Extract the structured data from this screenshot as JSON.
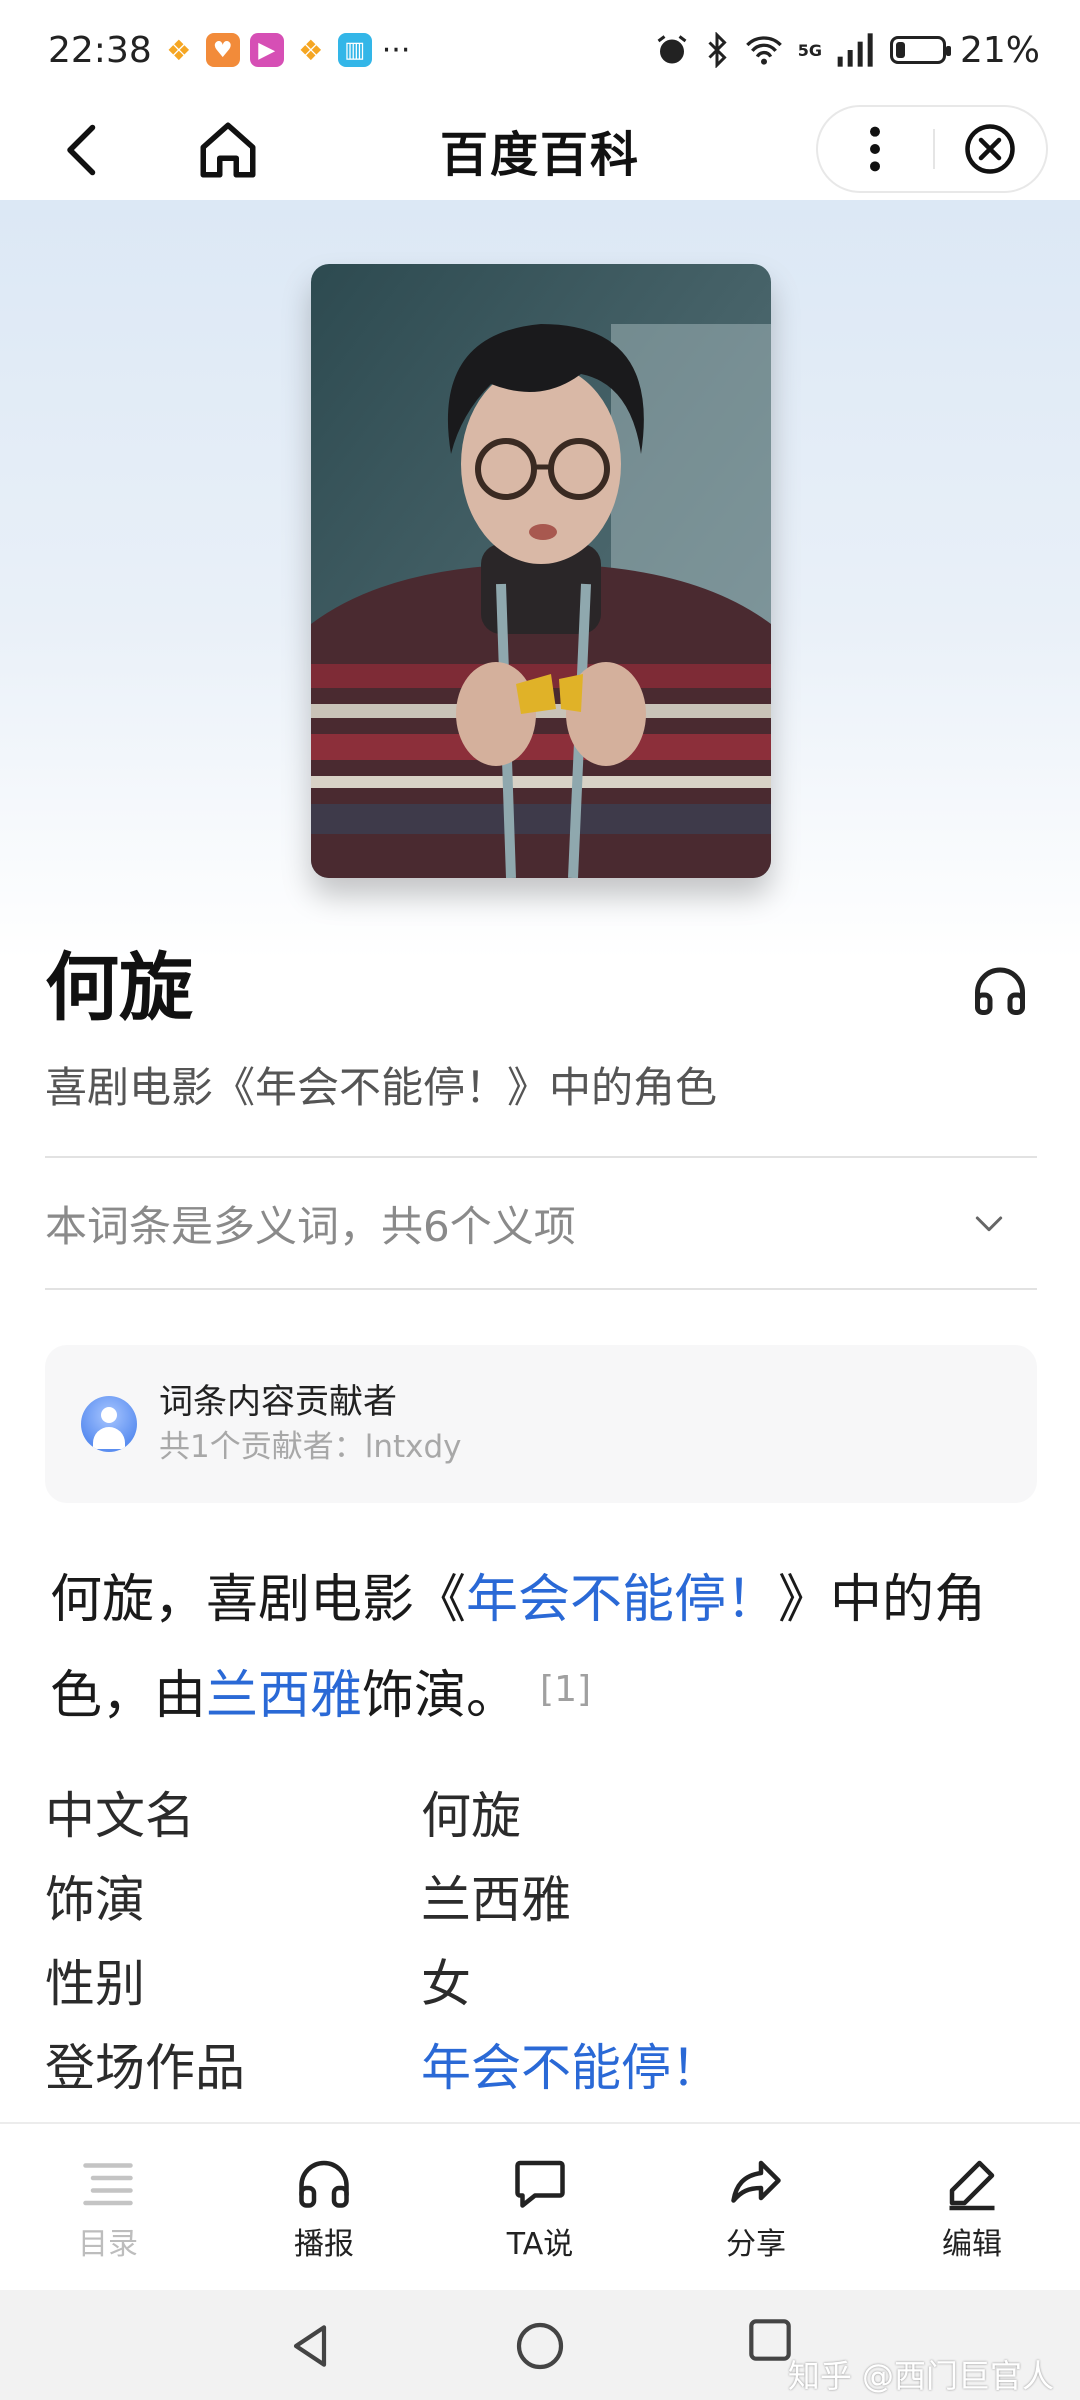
{
  "status_bar": {
    "time": "22:38",
    "more": "···",
    "network": "5G",
    "battery": "21%",
    "battery_level": 0.21
  },
  "nav": {
    "title": "百度百科"
  },
  "entry": {
    "title": "何旋",
    "subtitle": "喜剧电影《年会不能停！》中的角色",
    "polysemy_text": "本词条是多义词，共6个义项"
  },
  "contributors": {
    "heading": "词条内容贡献者",
    "detail": "共1个贡献者：lntxdy"
  },
  "summary": {
    "p1": "何旋，喜剧电影《",
    "link1": "年会不能停！",
    "p2": "》中的角色，由",
    "link2": "兰西雅",
    "p3": "饰演。",
    "ref": "[1]"
  },
  "infobox": {
    "rows": [
      {
        "key": "中文名",
        "value": "何旋"
      },
      {
        "key": "饰演",
        "value": "兰西雅"
      },
      {
        "key": "性别",
        "value": "女"
      },
      {
        "key": "登场作品",
        "value": "年会不能停！"
      }
    ]
  },
  "bottom_bar": {
    "items": [
      {
        "label": "目录",
        "icon": "toc-icon"
      },
      {
        "label": "播报",
        "icon": "headphones-icon"
      },
      {
        "label": "TA说",
        "icon": "chat-bubble-icon"
      },
      {
        "label": "分享",
        "icon": "share-icon"
      },
      {
        "label": "编辑",
        "icon": "edit-pen-icon"
      }
    ]
  },
  "watermark": "知乎 @西门巨官人",
  "colors": {
    "link": "#2a69d6",
    "hero_top": "#dce8f5"
  }
}
